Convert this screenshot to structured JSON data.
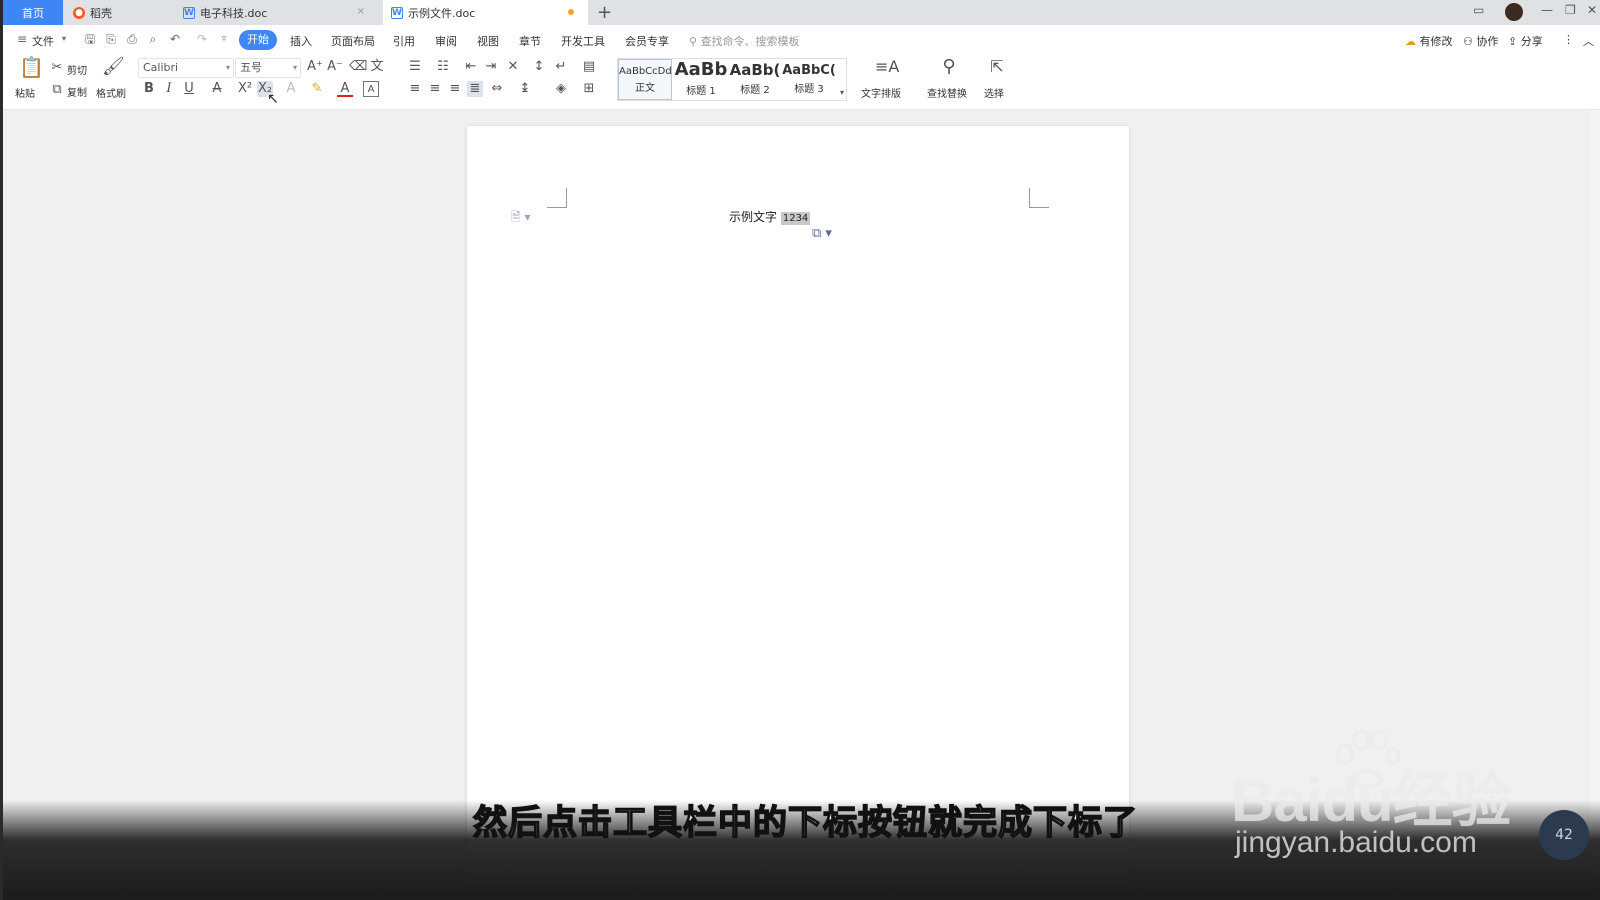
{
  "tabs": {
    "home": "首页",
    "daoke": "稻壳",
    "doc1": "电子科技.doc",
    "doc2": "示例文件.doc",
    "add": "+"
  },
  "menu": {
    "file": "文件",
    "start": "开始",
    "insert": "插入",
    "layout": "页面布局",
    "reference": "引用",
    "review": "审阅",
    "view": "视图",
    "chapter": "章节",
    "devtools": "开发工具",
    "member": "会员专享",
    "search_placeholder": "查找命令、搜索模板",
    "has_changes": "有修改",
    "collab": "协作",
    "share": "分享"
  },
  "ribbon": {
    "paste": "粘贴",
    "cut": "剪切",
    "copy": "复制",
    "format_painter": "格式刷",
    "font_name": "Calibri",
    "font_size": "五号",
    "styles": [
      {
        "sample": "AaBbCcDd",
        "name": "正文"
      },
      {
        "sample": "AaBb",
        "name": "标题 1"
      },
      {
        "sample": "AaBb(",
        "name": "标题 2"
      },
      {
        "sample": "AaBbC(",
        "name": "标题 3"
      }
    ],
    "text_layout": "文字排版",
    "find_replace": "查找替换",
    "select": "选择"
  },
  "document": {
    "text": "示例文字",
    "selected": "1234"
  },
  "overlay": {
    "subtitle": "然后点击工具栏中的下标按钮就完成下标了",
    "watermark": "Baidu经验",
    "watermark_url": "jingyan.baidu.com",
    "badge": "42"
  }
}
